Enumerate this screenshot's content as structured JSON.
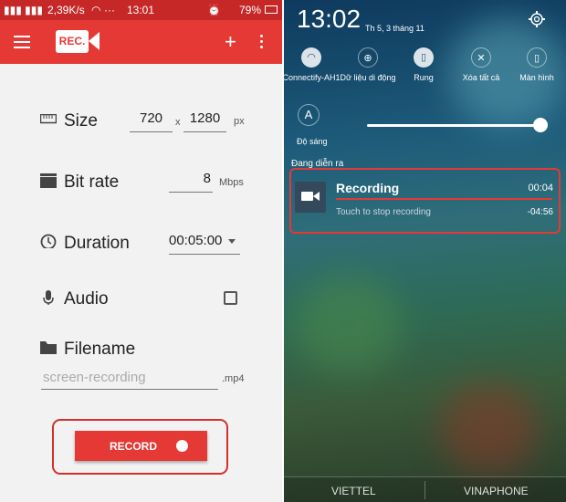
{
  "left": {
    "status": {
      "signal_speed": "2,39K/s",
      "dots": "···",
      "time": "13:01",
      "battery": "79%"
    },
    "appbar": {
      "logo_text": "REC.",
      "add_glyph": "+"
    },
    "size": {
      "label": "Size",
      "width": "720",
      "sep": "x",
      "height": "1280",
      "unit": "px"
    },
    "bitrate": {
      "label": "Bit rate",
      "value": "8",
      "unit": "Mbps"
    },
    "duration": {
      "label": "Duration",
      "value": "00:05:00"
    },
    "audio": {
      "label": "Audio",
      "checked": false
    },
    "filename": {
      "label": "Filename",
      "placeholder": "screen-recording",
      "ext": ".mp4"
    },
    "record_button": "RECORD"
  },
  "right": {
    "clock": "13:02",
    "date": "Th 5, 3 tháng 11",
    "quick_settings": [
      {
        "label": "Connectify-AH1",
        "icon": "wifi-icon"
      },
      {
        "label": "Dữ liệu di động",
        "icon": "globe-icon"
      },
      {
        "label": "Rung",
        "icon": "vibrate-icon"
      },
      {
        "label": "Xóa tất cả",
        "icon": "close-icon"
      },
      {
        "label": "Màn hình",
        "icon": "screen-icon"
      }
    ],
    "brightness": {
      "glyph": "A",
      "label": "Độ sáng",
      "level": 1.0
    },
    "ongoing_label": "Đang diễn ra",
    "notification": {
      "title": "Recording",
      "elapsed": "00:04",
      "subtitle": "Touch to stop recording",
      "remaining": "-04:56"
    },
    "carriers": [
      "VIETTEL",
      "VINAPHONE"
    ]
  }
}
